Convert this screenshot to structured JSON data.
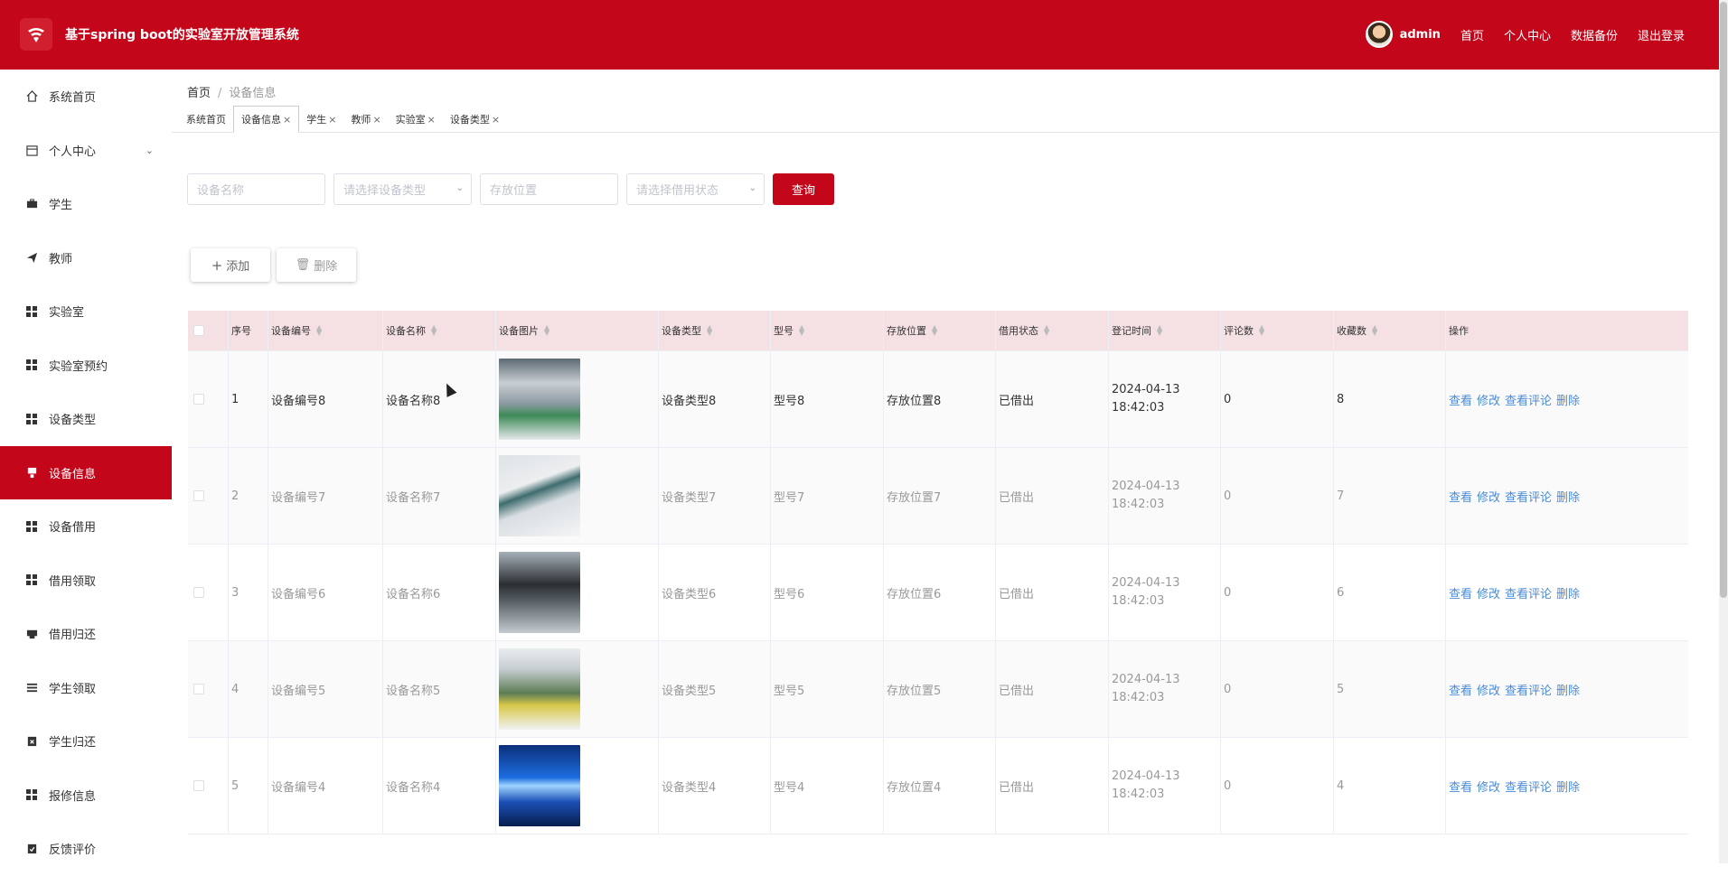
{
  "header": {
    "title": "基于spring boot的实验室开放管理系统",
    "username": "admin",
    "links": [
      "首页",
      "个人中心",
      "数据备份",
      "退出登录"
    ],
    "accent": "#c4061b"
  },
  "sidebar": {
    "items": [
      {
        "label": "系统首页",
        "icon": "home-icon"
      },
      {
        "label": "个人中心",
        "icon": "calendar-icon",
        "expandable": true
      },
      {
        "label": "学生",
        "icon": "briefcase-icon"
      },
      {
        "label": "教师",
        "icon": "send-icon"
      },
      {
        "label": "实验室",
        "icon": "grid-icon"
      },
      {
        "label": "实验室预约",
        "icon": "grid-icon"
      },
      {
        "label": "设备类型",
        "icon": "grid-icon"
      },
      {
        "label": "设备信息",
        "icon": "tag-icon",
        "active": true
      },
      {
        "label": "设备借用",
        "icon": "grid-icon"
      },
      {
        "label": "借用领取",
        "icon": "grid-icon"
      },
      {
        "label": "借用归还",
        "icon": "print-icon"
      },
      {
        "label": "学生领取",
        "icon": "list-icon"
      },
      {
        "label": "学生归还",
        "icon": "clipboard-icon"
      },
      {
        "label": "报修信息",
        "icon": "grid-icon"
      },
      {
        "label": "反馈评价",
        "icon": "clipboard-check-icon"
      }
    ]
  },
  "breadcrumb": {
    "home": "首页",
    "current": "设备信息"
  },
  "tabs": [
    {
      "label": "系统首页",
      "closable": false
    },
    {
      "label": "设备信息",
      "closable": true,
      "active": true
    },
    {
      "label": "学生",
      "closable": true
    },
    {
      "label": "教师",
      "closable": true
    },
    {
      "label": "实验室",
      "closable": true
    },
    {
      "label": "设备类型",
      "closable": true
    }
  ],
  "search": {
    "name_placeholder": "设备名称",
    "type_placeholder": "请选择设备类型",
    "location_placeholder": "存放位置",
    "status_placeholder": "请选择借用状态",
    "button": "查询"
  },
  "actions": {
    "add": "添加",
    "delete": "删除"
  },
  "table": {
    "columns": [
      "序号",
      "设备编号",
      "设备名称",
      "设备图片",
      "设备类型",
      "型号",
      "存放位置",
      "借用状态",
      "登记时间",
      "评论数",
      "收藏数",
      "操作"
    ],
    "ops": [
      "查看",
      "修改",
      "查看评论",
      "删除"
    ],
    "rows": [
      {
        "idx": "1",
        "code": "设备编号8",
        "name": "设备名称8",
        "type": "设备类型8",
        "model": "型号8",
        "loc": "存放位置8",
        "status": "已借出",
        "time": "2024-04-13 18:42:03",
        "comments": "0",
        "favs": "8"
      },
      {
        "idx": "2",
        "code": "设备编号7",
        "name": "设备名称7",
        "type": "设备类型7",
        "model": "型号7",
        "loc": "存放位置7",
        "status": "已借出",
        "time": "2024-04-13 18:42:03",
        "comments": "0",
        "favs": "7"
      },
      {
        "idx": "3",
        "code": "设备编号6",
        "name": "设备名称6",
        "type": "设备类型6",
        "model": "型号6",
        "loc": "存放位置6",
        "status": "已借出",
        "time": "2024-04-13 18:42:03",
        "comments": "0",
        "favs": "6"
      },
      {
        "idx": "4",
        "code": "设备编号5",
        "name": "设备名称5",
        "type": "设备类型5",
        "model": "型号5",
        "loc": "存放位置5",
        "status": "已借出",
        "time": "2024-04-13 18:42:03",
        "comments": "0",
        "favs": "5"
      },
      {
        "idx": "5",
        "code": "设备编号4",
        "name": "设备名称4",
        "type": "设备类型4",
        "model": "型号4",
        "loc": "存放位置4",
        "status": "已借出",
        "time": "2024-04-13 18:42:03",
        "comments": "0",
        "favs": "4"
      }
    ]
  }
}
